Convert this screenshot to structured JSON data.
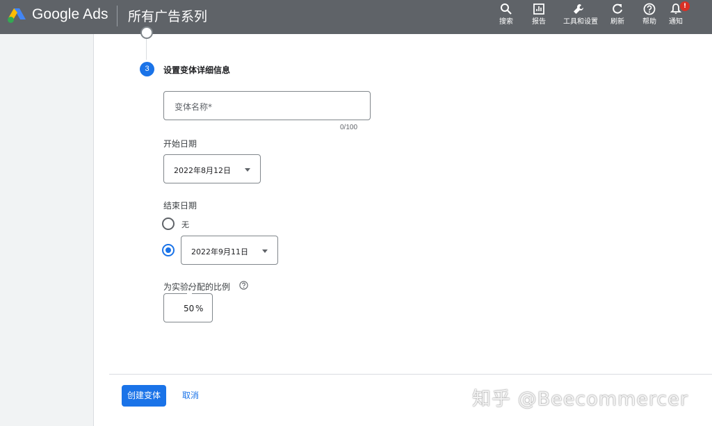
{
  "header": {
    "brand": "Google Ads",
    "title": "所有广告系列",
    "actions": [
      {
        "icon": "search-icon",
        "label": "搜索"
      },
      {
        "icon": "reports-icon",
        "label": "报告"
      },
      {
        "icon": "wrench-icon",
        "label": "工具和设置"
      },
      {
        "icon": "refresh-icon",
        "label": "刷新"
      },
      {
        "icon": "help-icon",
        "label": "帮助"
      },
      {
        "icon": "bell-icon",
        "label": "通知",
        "badge": "!"
      }
    ]
  },
  "step": {
    "number": "3",
    "title": "设置变体详细信息"
  },
  "form": {
    "name_placeholder": "变体名称*",
    "char_count": "0/100",
    "start_date_label": "开始日期",
    "start_date_value": "2022年8月12日",
    "end_date_label": "结束日期",
    "end_none_label": "无",
    "end_date_value": "2022年9月11日",
    "end_date_selected": "date",
    "split_label": "为实验分配的比例",
    "split_required": "*",
    "split_value": "50",
    "split_unit": "%"
  },
  "footer": {
    "create_label": "创建变体",
    "cancel_label": "取消"
  },
  "watermark": "知乎 @Beecommercer",
  "colors": {
    "topbar": "#5f6368",
    "primary": "#1a73e8",
    "badge": "#d93025"
  }
}
